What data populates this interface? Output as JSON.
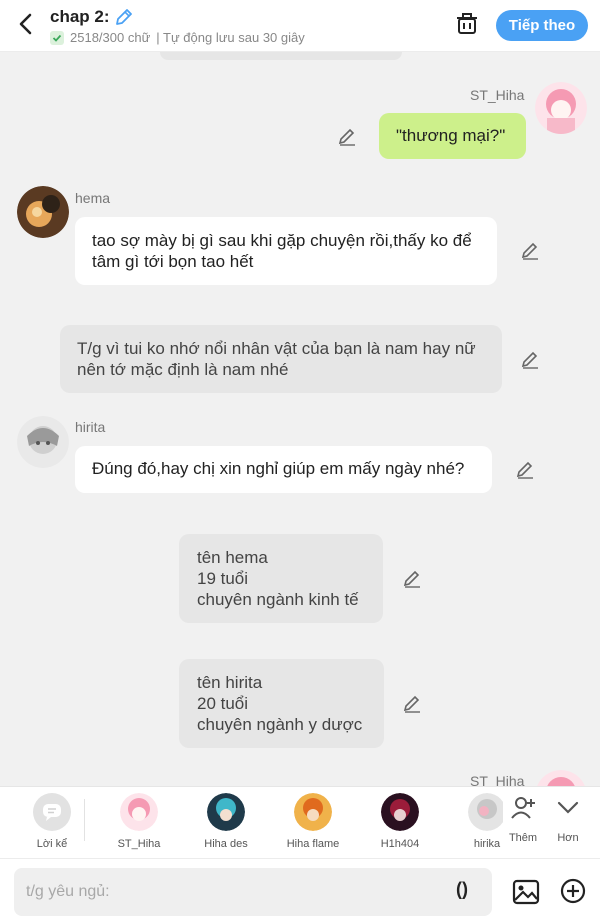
{
  "header": {
    "title": "chap 2:",
    "word_count": "2518/300 chữ",
    "autosave": "| Tự động lưu sau 30 giây",
    "next_label": "Tiếp theo",
    "accent": "#4aa1f4"
  },
  "messages": [
    {
      "speaker": "ST_Hiha",
      "text": "\"thương mại?\"",
      "side": "right",
      "style": "green"
    },
    {
      "speaker": "hema",
      "text": "tao sợ mày bị gì sau khi gặp chuyện rồi,thấy ko để tâm gì tới bọn tao hết",
      "side": "left",
      "style": "white"
    },
    {
      "speaker": "",
      "text": "T/g vì tui ko nhớ nổi nhân vật của bạn là nam hay nữ nên tớ mặc định là nam nhé",
      "side": "narration",
      "style": "gray"
    },
    {
      "speaker": "hirita",
      "text": "Đúng đó,hay chị xin nghỉ giúp em mấy ngày nhé?",
      "side": "left",
      "style": "white"
    },
    {
      "speaker": "",
      "text": "tên hema\n19 tuổi\nchuyên ngành kinh tế",
      "side": "center",
      "style": "gray"
    },
    {
      "speaker": "",
      "text": "tên hirita\n20 tuổi\nchuyên ngành y dược",
      "side": "center",
      "style": "gray"
    },
    {
      "speaker": "ST_Hiha",
      "text": "",
      "side": "right",
      "style": "peek"
    }
  ],
  "charbar": {
    "narrator_label": "Lời kể",
    "characters": [
      {
        "name": "ST_Hiha",
        "color": "#f6a6be"
      },
      {
        "name": "Hiha des",
        "color": "#3fb7c9"
      },
      {
        "name": "Hiha flame",
        "color": "#e88a2e"
      },
      {
        "name": "H1h404",
        "color": "#9b1c3a"
      },
      {
        "name": "hirika",
        "color": "#c7c7c7"
      }
    ],
    "add_label": "Thêm",
    "more_label": "Hơn"
  },
  "input": {
    "placeholder": "t/g yêu ngủ:",
    "paren_label": "()"
  }
}
